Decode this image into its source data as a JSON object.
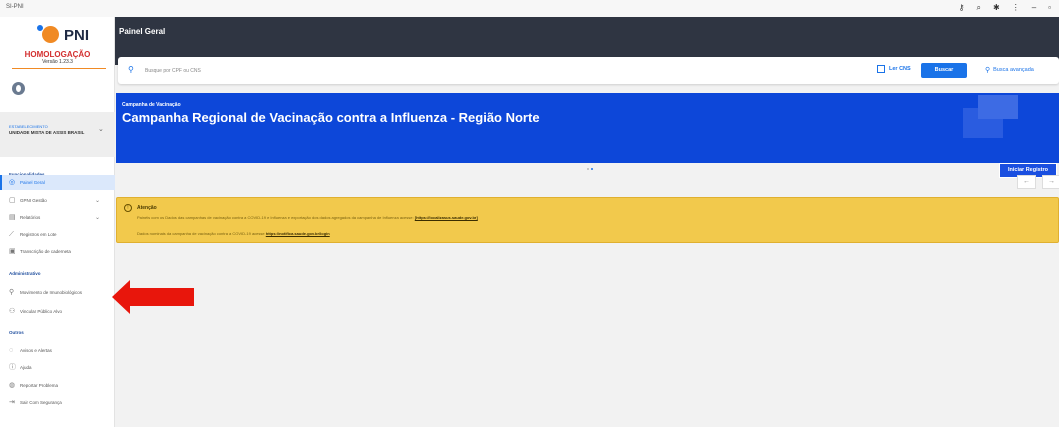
{
  "browser": {
    "tab_title": "SI-PNI"
  },
  "sidebar": {
    "logo_text": "PNI",
    "environment": "HOMOLOGAÇÃO",
    "version": "Versão 1.23.3",
    "establishment_label": "ESTABELECIMENTO",
    "establishment_value": "UNIDADE MISTA DE ASSIS BRASIL",
    "sections": {
      "functionalities": "Funcionalidades",
      "administrative": "Administrativo",
      "others": "Outros"
    },
    "items": [
      {
        "label": "Painel Geral",
        "icon": "dashboard-icon",
        "active": true
      },
      {
        "label": "GPNI Gestão",
        "icon": "document-icon",
        "active": false,
        "expandable": true
      },
      {
        "label": "Relatórios",
        "icon": "chart-icon",
        "active": false,
        "expandable": true
      },
      {
        "label": "Registros em Lote",
        "icon": "syringe-icon",
        "active": false
      },
      {
        "label": "Transcrição de caderneta",
        "icon": "transcription-icon",
        "active": false
      },
      {
        "label": "Movimento de Imunobiológicos",
        "icon": "vaccine-icon",
        "active": false
      },
      {
        "label": "Vincular Público Alvo",
        "icon": "user-link-icon",
        "active": false
      },
      {
        "label": "Avisos e Alertas",
        "icon": "bell-icon",
        "active": false
      },
      {
        "label": "Ajuda",
        "icon": "help-icon",
        "active": false
      },
      {
        "label": "Reportar Problema",
        "icon": "report-icon",
        "active": false
      },
      {
        "label": "Sair Com Segurança",
        "icon": "logout-icon",
        "active": false
      }
    ]
  },
  "header": {
    "title": "Painel Geral"
  },
  "search": {
    "placeholder": "Busque por CPF ou CNS",
    "ler_cns": "Ler CNS",
    "buscar": "Buscar",
    "busca_avancada": "Busca avançada"
  },
  "banner": {
    "subtitle": "Campanha de Vacinação",
    "title": "Campanha Regional de Vacinação contra a Influenza - Região Norte",
    "button": "Iniciar Registro"
  },
  "alert": {
    "title": "Atenção",
    "line1": "Painéis com os Dados das campanhas de vacinação contra a COVID-19 e Influenza e exportação dos dados agregados da campanha de Influenza acesse:",
    "line1_link": "[https://localizasus.saude.gov.br]",
    "line2": "Dados nominais da campanha de vacinação contra a COVID-19 acesse",
    "line2_link": "https://notifica.saude.gov.br/login"
  },
  "colors": {
    "sidebar_active": "#1a73e8",
    "header_bg": "#2f3542",
    "banner_bg": "#0d47d9",
    "alert_bg": "#f2c94c",
    "arrow": "#e8160c"
  }
}
